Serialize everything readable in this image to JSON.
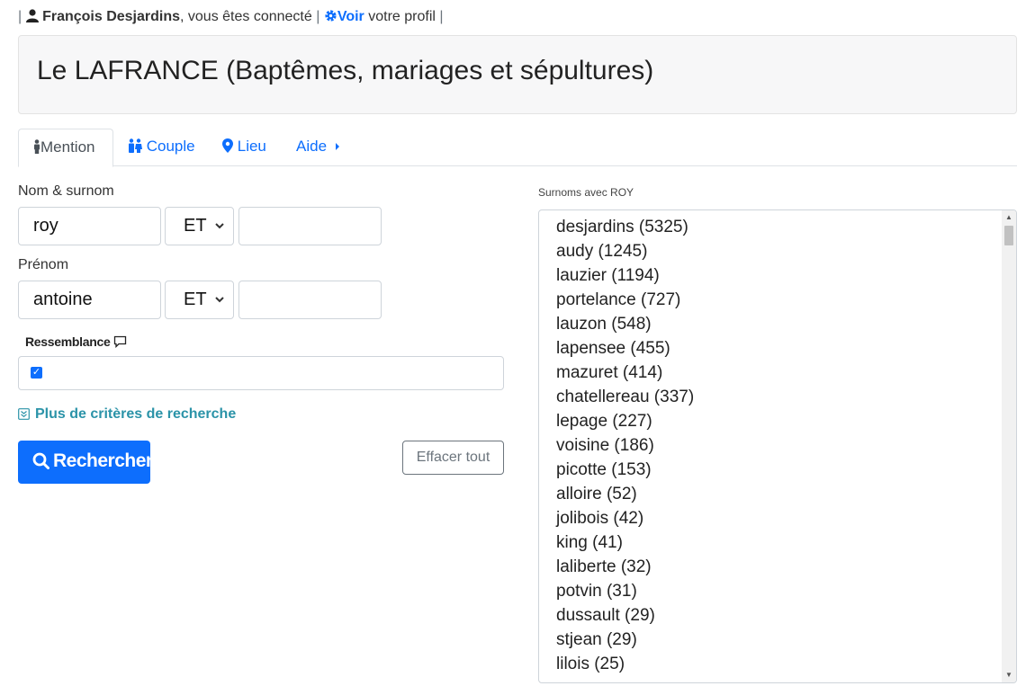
{
  "topbar": {
    "separator": "|",
    "user_name": "François Desjardins",
    "connected_text": ", vous êtes connecté",
    "voir_label": "Voir",
    "profile_text": "votre profil"
  },
  "page": {
    "title": "Le LAFRANCE (Baptêmes, mariages et sépultures)"
  },
  "tabs": [
    {
      "label": "Mention",
      "icon": "person-icon",
      "active": true
    },
    {
      "label": "Couple",
      "icon": "couple-icon",
      "active": false
    },
    {
      "label": "Lieu",
      "icon": "map-marker-icon",
      "active": false
    },
    {
      "label": "Aide",
      "icon": "caret-right-icon",
      "active": false
    }
  ],
  "form": {
    "nom_label": "Nom & surnom",
    "nom_value": "roy",
    "nom_operator": "ET",
    "nom_extra_value": "",
    "prenom_label": "Prénom",
    "prenom_value": "antoine",
    "prenom_operator": "ET",
    "prenom_extra_value": "",
    "resemblance_label": "Ressemblance",
    "resemblance_checked": true,
    "more_criteria_label": "Plus de critères de recherche",
    "search_button": "Rechercher",
    "clear_button": "Effacer tout"
  },
  "surnoms": {
    "label": "Surnoms avec ROY",
    "items": [
      "desjardins (5325)",
      "audy (1245)",
      "lauzier (1194)",
      "portelance (727)",
      "lauzon (548)",
      "lapensee (455)",
      "mazuret (414)",
      "chatellereau (337)",
      "lepage (227)",
      "voisine (186)",
      "picotte (153)",
      "alloire (52)",
      "jolibois (42)",
      "king (41)",
      "laliberte (32)",
      "potvin (31)",
      "dussault (29)",
      "stjean (29)",
      "lilois (25)"
    ]
  },
  "colors": {
    "primary": "#0d6efd",
    "teal": "#2b93a8",
    "secondary": "#6c757d"
  }
}
